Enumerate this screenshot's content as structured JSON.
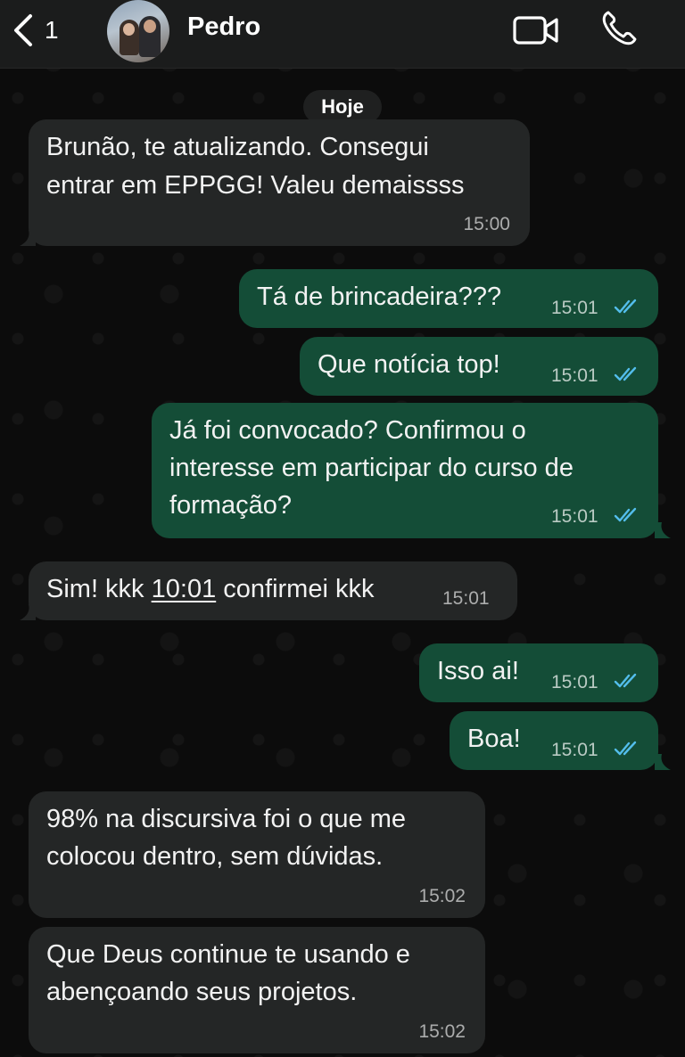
{
  "header": {
    "back_count": "1",
    "contact_name": "Pedro"
  },
  "date_chip": "Hoje",
  "messages": [
    {
      "dir": "in",
      "lines": [
        "Brunão, te atualizando. Consegui",
        "entrar em EPPGG! Valeu demaissss"
      ],
      "time": "15:00"
    },
    {
      "dir": "out",
      "lines": [
        "Tá de brincadeira???"
      ],
      "time": "15:01",
      "read": true
    },
    {
      "dir": "out",
      "lines": [
        "Que notícia top!"
      ],
      "time": "15:01",
      "read": true
    },
    {
      "dir": "out",
      "lines": [
        "Já foi convocado? Confirmou o",
        "interesse em participar do curso de",
        "formação?"
      ],
      "time": "15:01",
      "read": true
    },
    {
      "dir": "in",
      "text_before": "Sim! kkk ",
      "link": "10:01",
      "text_after": " confirmei kkk",
      "time": "15:01"
    },
    {
      "dir": "out",
      "lines": [
        "Isso ai!"
      ],
      "time": "15:01",
      "read": true
    },
    {
      "dir": "out",
      "lines": [
        "Boa!"
      ],
      "time": "15:01",
      "read": true
    },
    {
      "dir": "in",
      "lines": [
        "98% na discursiva foi o que me",
        "colocou dentro, sem dúvidas."
      ],
      "time": "15:02"
    },
    {
      "dir": "in",
      "lines": [
        "Que Deus continue te usando e",
        "abençoando seus projetos."
      ],
      "time": "15:02"
    }
  ],
  "colors": {
    "incoming_bubble": "#242626",
    "outgoing_bubble": "#144d37",
    "read_ticks": "#53bdeb",
    "header_bg": "#1b1c1c"
  },
  "icons": {
    "back": "chevron-left-icon",
    "video": "video-camera-icon",
    "call": "phone-icon",
    "read": "double-check-icon"
  }
}
